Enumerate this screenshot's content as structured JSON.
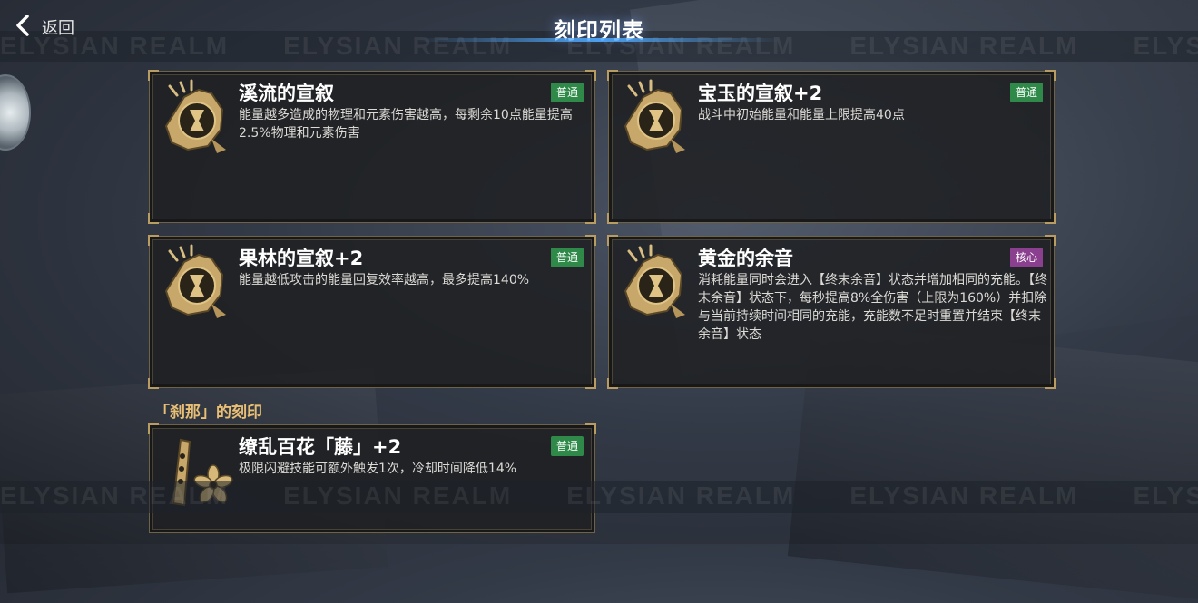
{
  "header": {
    "back_label": "返回",
    "title": "刻印列表"
  },
  "watermark": "ELYSIAN REALM",
  "colors": {
    "badge_normal": "#2f8a4a",
    "badge_core": "#8a3f8f",
    "section_heading": "#e8bf75",
    "card_border": "#b89c62"
  },
  "cards": [
    {
      "title": "溪流的宣叙",
      "badge": "普通",
      "badge_type": "normal",
      "icon": "hourglass-emblem-icon",
      "description": "能量越多造成的物理和元素伤害越高，每剩余10点能量提高2.5%物理和元素伤害"
    },
    {
      "title": "宝玉的宣叙+2",
      "badge": "普通",
      "badge_type": "normal",
      "icon": "hourglass-emblem-icon",
      "description": "战斗中初始能量和能量上限提高40点"
    },
    {
      "title": "果林的宣叙+2",
      "badge": "普通",
      "badge_type": "normal",
      "icon": "hourglass-emblem-icon",
      "description": "能量越低攻击的能量回复效率越高，最多提高140%"
    },
    {
      "title": "黄金的余音",
      "badge": "核心",
      "badge_type": "core",
      "icon": "hourglass-emblem-icon",
      "description": "消耗能量同时会进入【终末余音】状态并增加相同的充能。【终末余音】状态下，每秒提高8%全伤害（上限为160%）并扣除与当前持续时间相同的充能，充能数不足时重置并结束【终末余音】状态"
    }
  ],
  "section": {
    "heading": "「刹那」的刻印",
    "cards": [
      {
        "title": "缭乱百花「藤」+2",
        "badge": "普通",
        "badge_type": "normal",
        "icon": "flower-fan-icon",
        "description": "极限闪避技能可额外触发1次，冷却时间降低14%"
      }
    ]
  }
}
